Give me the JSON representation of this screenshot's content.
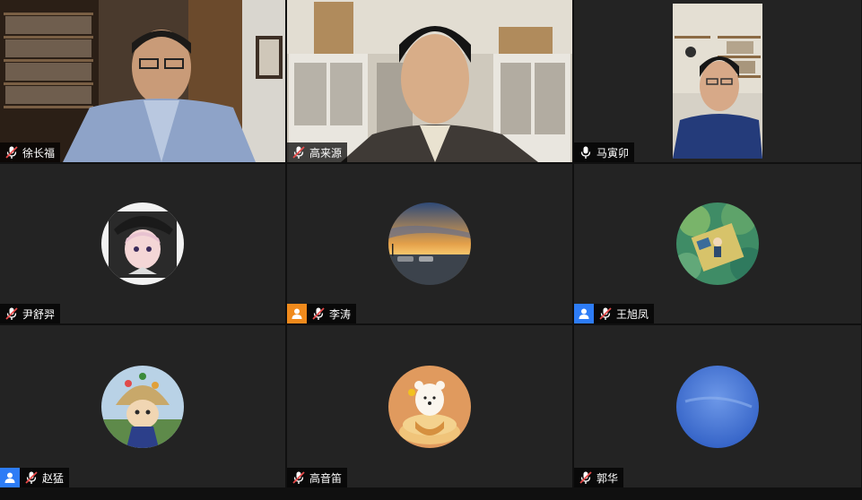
{
  "meeting": {
    "participants": [
      {
        "name": "徐长福",
        "mic": "muted",
        "type": "video"
      },
      {
        "name": "高来源",
        "mic": "muted",
        "type": "video"
      },
      {
        "name": "马寅卯",
        "mic": "on",
        "type": "video",
        "active_speaker": true
      },
      {
        "name": "尹舒羿",
        "mic": "muted",
        "type": "avatar"
      },
      {
        "name": "李涛",
        "mic": "muted",
        "type": "avatar",
        "badge": "person-icon",
        "badge_color": "#f08a1c"
      },
      {
        "name": "王旭凤",
        "mic": "muted",
        "type": "avatar",
        "badge": "person-icon",
        "badge_color": "#2d7cf6"
      },
      {
        "name": "赵猛",
        "mic": "muted",
        "type": "avatar",
        "badge": "person-icon",
        "badge_color": "#2d7cf6"
      },
      {
        "name": "高音笛",
        "mic": "muted",
        "type": "avatar"
      },
      {
        "name": "郭华",
        "mic": "muted",
        "type": "avatar"
      }
    ]
  },
  "colors": {
    "tile_bg": "#232323",
    "active_border": "#3ecf66",
    "mute_red": "#e84a4a",
    "badge_orange": "#f08a1c",
    "badge_blue": "#2d7cf6"
  }
}
